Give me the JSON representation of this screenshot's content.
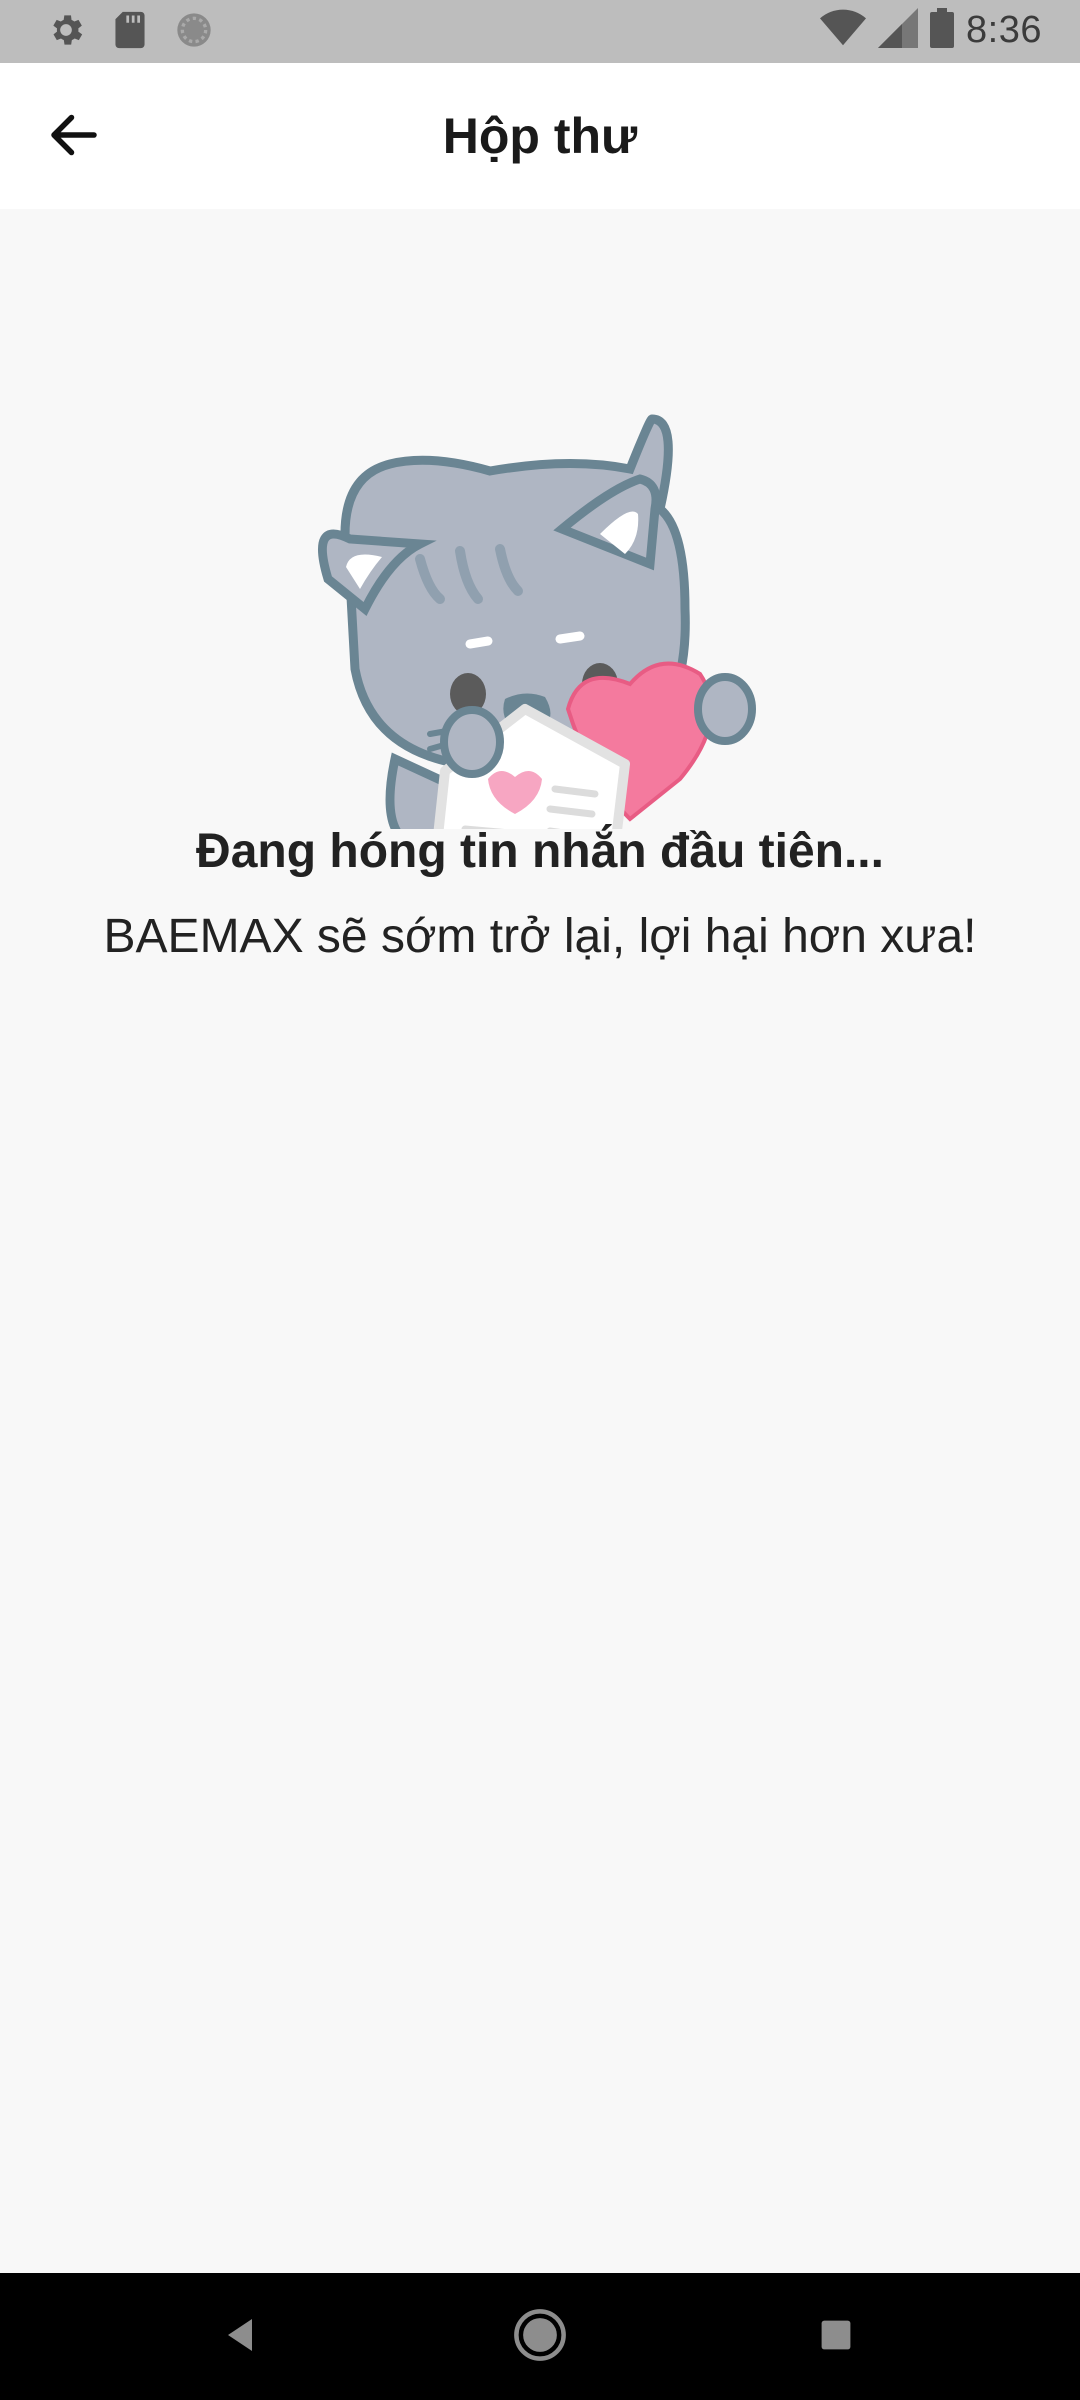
{
  "status_bar": {
    "time": "8:36",
    "icons": [
      "settings-icon",
      "sd-card-icon",
      "loading-circle-icon",
      "wifi-icon",
      "signal-icon",
      "battery-icon"
    ]
  },
  "app_bar": {
    "title": "Hộp thư",
    "back_icon": "arrow-left-icon"
  },
  "empty_state": {
    "illustration": "cat-holding-letter-and-heart",
    "title": "Đang hóng tin nhắn đầu tiên...",
    "subtitle": "BAEMAX sẽ sớm trở lại, lợi hại hơn xưa!"
  },
  "nav_bar": {
    "buttons": [
      "back-triangle-icon",
      "home-circle-icon",
      "recents-square-icon"
    ]
  },
  "colors": {
    "status_bar_bg": "#bdbdbd",
    "app_bar_bg": "#ffffff",
    "content_bg": "#f8f8f8",
    "nav_bar_bg": "#000000",
    "cat_body": "#afb6c3",
    "cat_outline": "#6a8593",
    "heart": "#f47a9e"
  }
}
